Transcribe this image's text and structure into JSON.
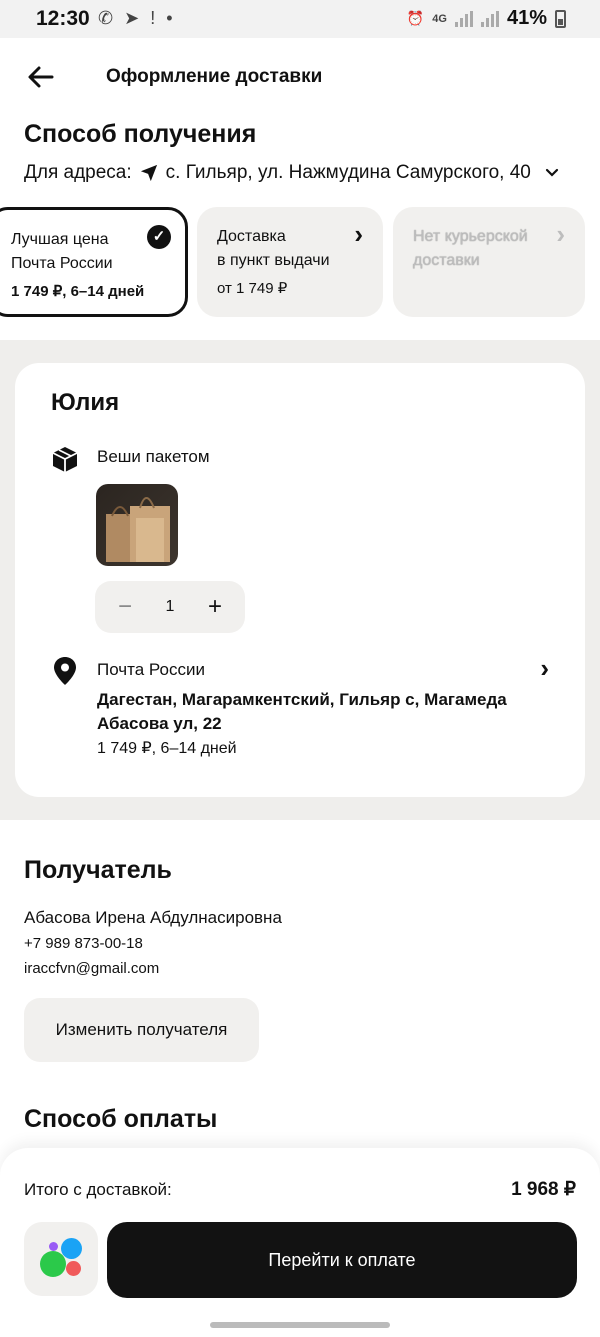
{
  "status_bar": {
    "time": "12:30",
    "network": "4G",
    "battery": "41%",
    "left_icons": [
      "whatsapp-icon",
      "telegram-icon",
      "notification-icon",
      "dot"
    ],
    "right_icons": [
      "alarm-icon",
      "network-4g-icon",
      "signal-icon",
      "signal-icon",
      "battery-icon"
    ]
  },
  "header": {
    "title": "Оформление доставки",
    "back_icon": "arrow-left-icon"
  },
  "delivery_method": {
    "title": "Способ получения",
    "address_prefix": "Для адреса:",
    "address": "с. Гильяр, ул. Нажмудина Самурского, 40",
    "options": [
      {
        "line1": "Лучшая цена",
        "line2": "Почта России",
        "price": "1 749 ₽, 6–14 дней",
        "selected": true
      },
      {
        "line1": "Доставка",
        "line2": "в пункт выдачи",
        "price": "от 1 749 ₽",
        "selected": false
      },
      {
        "line1": "Нет курьерской",
        "line2": "доставки",
        "price": "",
        "disabled": true
      }
    ]
  },
  "seller_card": {
    "name": "Юлия",
    "item_title": "Веши пакетом",
    "quantity": "1",
    "minus": "−",
    "plus": "+",
    "pickup_title": "Почта России",
    "pickup_address": "Дагестан, Магарамкентский, Гильяр с, Магамеда Абасова ул, 22",
    "pickup_price": "1 749 ₽, 6–14 дней"
  },
  "recipient": {
    "title": "Получатель",
    "name": "Абасова Ирена Абдулнасировна",
    "phone": "+7 989 873-00-18",
    "email": "iraccfvn@gmail.com",
    "change_label": "Изменить получателя"
  },
  "payment": {
    "title": "Способ оплаты"
  },
  "bottom_bar": {
    "total_label": "Итого с доставкой:",
    "total_value": "1 968 ₽",
    "pay_label": "Перейти к оплате"
  },
  "colors": {
    "accent_dark": "#121212",
    "surface_grey": "#f1f0ee",
    "logo_green": "#2bc94a",
    "logo_blue": "#1aa3f5",
    "logo_red": "#f05a5a",
    "logo_purple": "#9a5cf5"
  }
}
